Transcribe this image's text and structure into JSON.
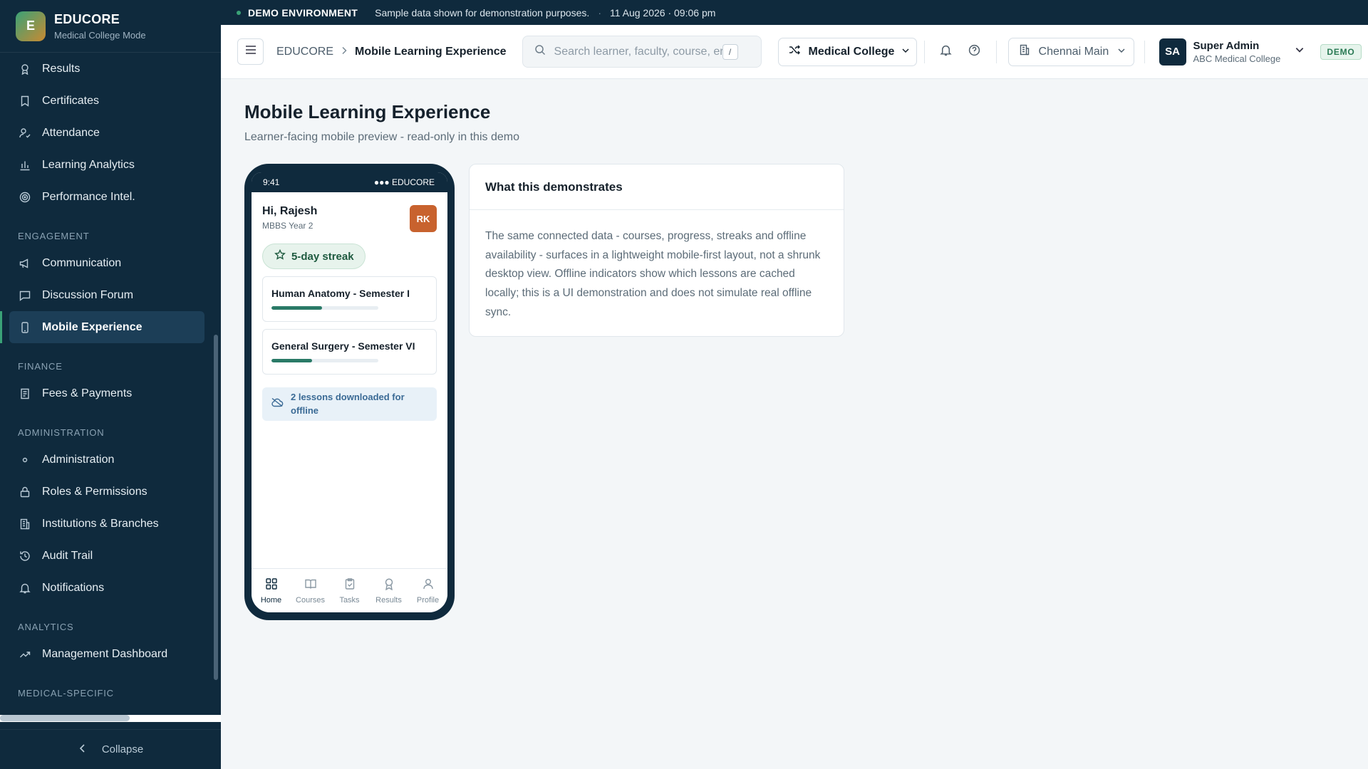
{
  "brand": {
    "logo_letter": "E",
    "title": "EDUCORE",
    "subtitle": "Medical College Mode"
  },
  "sidebar": {
    "items": [
      {
        "label": "Results",
        "icon": "award-icon"
      },
      {
        "label": "Certificates",
        "icon": "bookmark-icon"
      },
      {
        "label": "Attendance",
        "icon": "user-check-icon"
      },
      {
        "label": "Learning Analytics",
        "icon": "bar-chart-icon"
      },
      {
        "label": "Performance Intel.",
        "icon": "target-icon"
      }
    ],
    "sections": [
      {
        "title": "ENGAGEMENT",
        "items": [
          {
            "label": "Communication",
            "icon": "megaphone-icon"
          },
          {
            "label": "Discussion Forum",
            "icon": "message-square-icon"
          },
          {
            "label": "Mobile Experience",
            "icon": "smartphone-icon",
            "active": true
          }
        ]
      },
      {
        "title": "FINANCE",
        "items": [
          {
            "label": "Fees & Payments",
            "icon": "receipt-icon"
          }
        ]
      },
      {
        "title": "ADMINISTRATION",
        "items": [
          {
            "label": "Administration",
            "icon": "dot-icon"
          },
          {
            "label": "Roles & Permissions",
            "icon": "lock-icon"
          },
          {
            "label": "Institutions & Branches",
            "icon": "building-icon"
          },
          {
            "label": "Audit Trail",
            "icon": "history-icon"
          },
          {
            "label": "Notifications",
            "icon": "bell-icon"
          }
        ]
      },
      {
        "title": "ANALYTICS",
        "items": [
          {
            "label": "Management Dashboard",
            "icon": "trending-up-icon"
          }
        ]
      },
      {
        "title": "MEDICAL-SPECIFIC",
        "items": []
      }
    ],
    "collapse_label": "Collapse"
  },
  "banner": {
    "label": "DEMO ENVIRONMENT",
    "message": "Sample data shown for demonstration purposes.",
    "timestamp": "11 Aug 2026 · 09:06 pm"
  },
  "header": {
    "breadcrumb_home": "EDUCORE",
    "breadcrumb_current": "Mobile Learning Experience",
    "search_placeholder": "Search learner, faculty, course, er",
    "search_shortcut": "/",
    "mode_label": "Medical College",
    "branch_label": "Chennai Main",
    "user_initials": "SA",
    "user_name": "Super Admin",
    "user_org": "ABC Medical College",
    "demo_badge": "DEMO"
  },
  "page": {
    "title": "Mobile Learning Experience",
    "subtitle": "Learner-facing mobile preview - read-only in this demo"
  },
  "phone": {
    "time": "9:41",
    "carrier": "●●● EDUCORE",
    "greeting": "Hi, Rajesh",
    "greeting_sub": "MBBS Year 2",
    "initials": "RK",
    "streak": "5-day streak",
    "courses": [
      {
        "title": "Human Anatomy - Semester I",
        "progress": 0.47
      },
      {
        "title": "General Surgery - Semester VI",
        "progress": 0.38
      }
    ],
    "offline": "2 lessons downloaded for offline",
    "tabs": [
      {
        "label": "Home",
        "icon": "grid-icon",
        "active": true
      },
      {
        "label": "Courses",
        "icon": "book-open-icon"
      },
      {
        "label": "Tasks",
        "icon": "clipboard-check-icon"
      },
      {
        "label": "Results",
        "icon": "award-icon"
      },
      {
        "label": "Profile",
        "icon": "user-icon"
      }
    ]
  },
  "card": {
    "title": "What this demonstrates",
    "body": "The same connected data - courses, progress, streaks and offline availability - surfaces in a lightweight mobile-first layout, not a shrunk desktop view. Offline indicators show which lessons are cached locally; this is a UI demonstration and does not simulate real offline sync."
  },
  "colors": {
    "sidebar_bg": "#0f2a3d",
    "accent": "#3aa277",
    "progress": "#2a7a67",
    "avatar_rk": "#c8622e"
  }
}
